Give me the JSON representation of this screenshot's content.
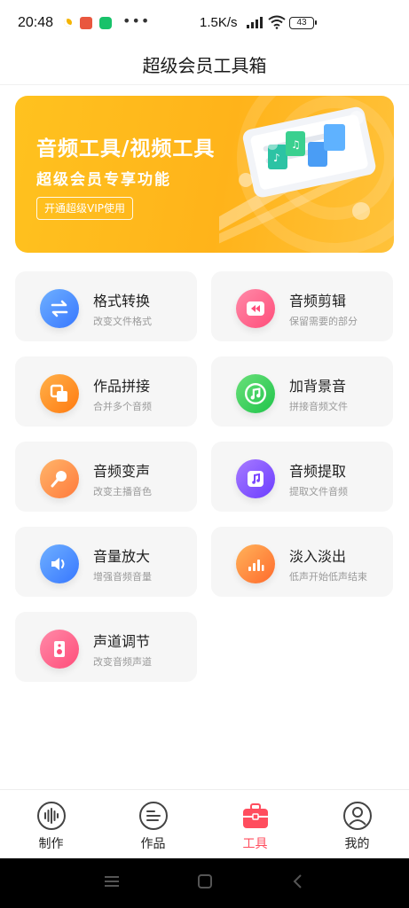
{
  "status_bar": {
    "time": "20:48",
    "network_speed": "1.5K/s",
    "battery": "43",
    "signal_icon": "signal-icon",
    "wifi_icon": "wifi-icon"
  },
  "header": {
    "title": "超级会员工具箱"
  },
  "banner": {
    "title": "音频工具/视频工具",
    "subtitle": "超级会员专享功能",
    "button_label": "开通超级VIP使用"
  },
  "tools": [
    {
      "title": "格式转换",
      "subtitle": "改变文件格式",
      "icon": "convert-icon",
      "color": "#3f8cff"
    },
    {
      "title": "音频剪辑",
      "subtitle": "保留需要的部分",
      "icon": "rewind-icon",
      "color": "#ff4d7a"
    },
    {
      "title": "作品拼接",
      "subtitle": "合并多个音频",
      "icon": "merge-icon",
      "color": "#ff8a1c"
    },
    {
      "title": "加背景音",
      "subtitle": "拼接音频文件",
      "icon": "music-note-icon",
      "color": "#2fd14f"
    },
    {
      "title": "音频变声",
      "subtitle": "改变主播音色",
      "icon": "microphone-icon",
      "color": "#ff8a3c"
    },
    {
      "title": "音频提取",
      "subtitle": "提取文件音频",
      "icon": "music-file-icon",
      "color": "#8a46ff"
    },
    {
      "title": "音量放大",
      "subtitle": "增强音频音量",
      "icon": "speaker-icon",
      "color": "#3f8cff"
    },
    {
      "title": "淡入淡出",
      "subtitle": "低声开始低声结束",
      "icon": "bars-icon",
      "color": "#ff7a2c"
    },
    {
      "title": "声道调节",
      "subtitle": "改变音频声道",
      "icon": "stereo-speaker-icon",
      "color": "#ff4d7a"
    }
  ],
  "tabbar": {
    "items": [
      {
        "label": "制作",
        "icon": "waveform-icon"
      },
      {
        "label": "作品",
        "icon": "list-icon"
      },
      {
        "label": "工具",
        "icon": "toolbox-icon"
      },
      {
        "label": "我的",
        "icon": "user-icon"
      }
    ],
    "active_index": 2,
    "active_color": "#ff4d5e"
  }
}
